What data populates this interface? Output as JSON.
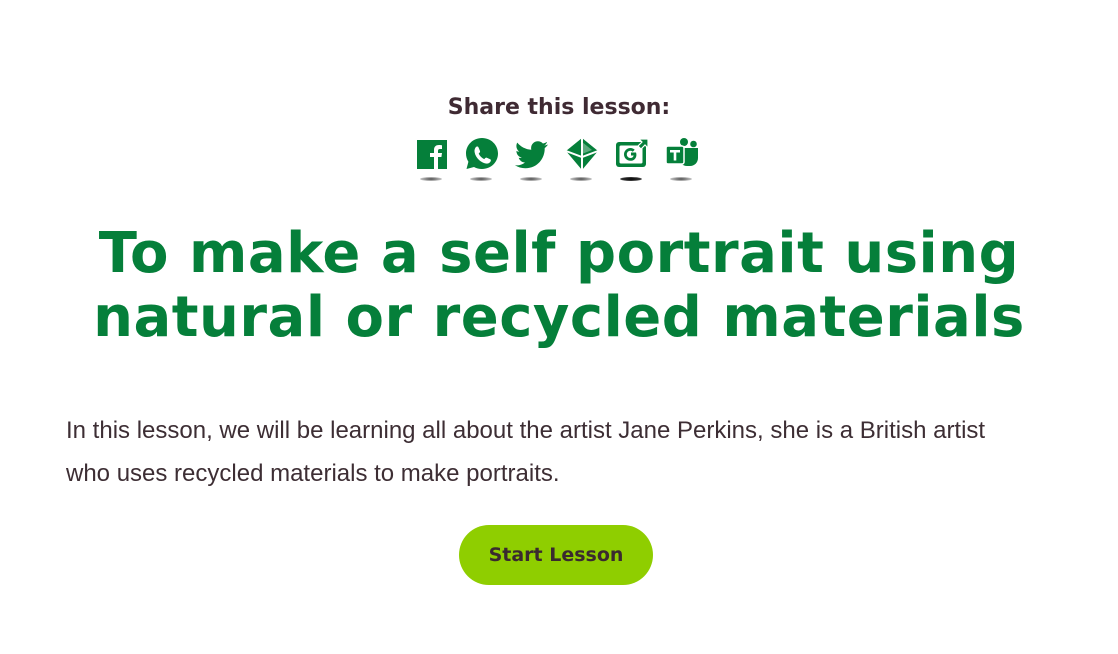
{
  "share": {
    "heading": "Share this lesson:",
    "icon_color": "#057f3a",
    "buttons": [
      {
        "icon": "facebook-icon"
      },
      {
        "icon": "whatsapp-icon"
      },
      {
        "icon": "twitter-icon"
      },
      {
        "icon": "google-classroom-icon"
      },
      {
        "icon": "google-share-icon"
      },
      {
        "icon": "microsoft-teams-icon"
      }
    ]
  },
  "lesson": {
    "title": "To make a self portrait using natural or recycled materials",
    "description": "In this lesson, we will be learning all about the artist Jane Perkins, she is a British artist who uses recycled materials to make portraits.",
    "title_color": "#057f3a"
  },
  "actions": {
    "start_label": "Start Lesson",
    "start_color": "#8fce00"
  }
}
